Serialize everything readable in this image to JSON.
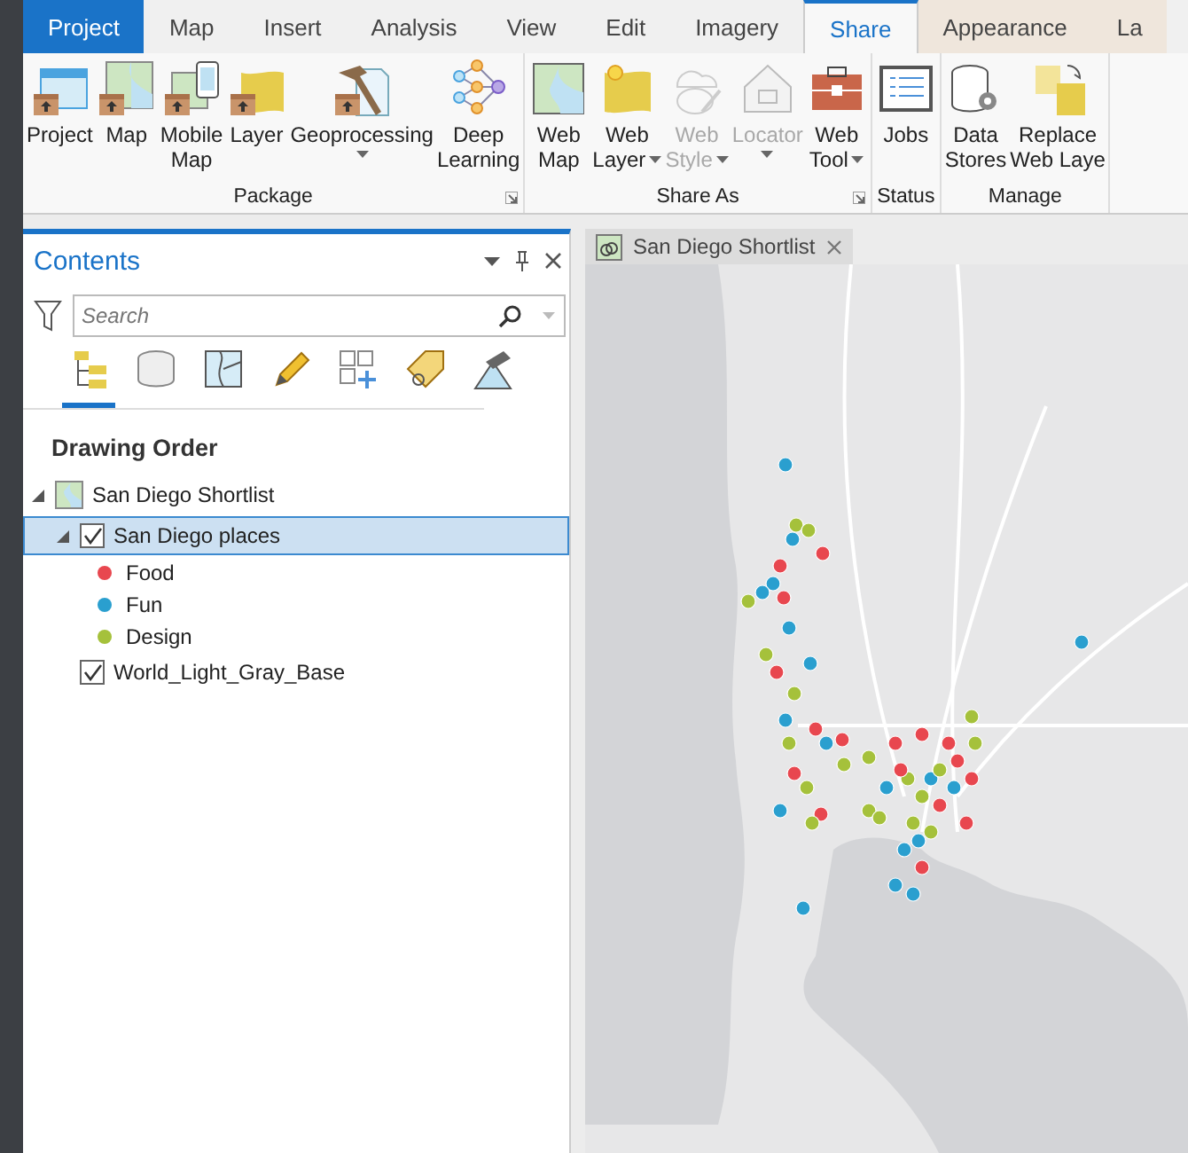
{
  "ribbon_tabs": [
    {
      "label": "Project",
      "kind": "file",
      "selected": false
    },
    {
      "label": "Map",
      "kind": "tab",
      "selected": false
    },
    {
      "label": "Insert",
      "kind": "tab",
      "selected": false
    },
    {
      "label": "Analysis",
      "kind": "tab",
      "selected": false
    },
    {
      "label": "View",
      "kind": "tab",
      "selected": false
    },
    {
      "label": "Edit",
      "kind": "tab",
      "selected": false
    },
    {
      "label": "Imagery",
      "kind": "tab",
      "selected": false
    },
    {
      "label": "Share",
      "kind": "tab",
      "selected": true
    },
    {
      "label": "Appearance",
      "kind": "contextual",
      "selected": false
    },
    {
      "label": "La",
      "kind": "contextual",
      "selected": false
    }
  ],
  "ribbon_groups": [
    {
      "label": "Package",
      "launcher": true,
      "buttons": [
        {
          "label": "Project",
          "dropdown": false,
          "disabled": false
        },
        {
          "label": "Map",
          "dropdown": false,
          "disabled": false
        },
        {
          "label": "Mobile\nMap",
          "dropdown": false,
          "disabled": false
        },
        {
          "label": "Layer",
          "dropdown": false,
          "disabled": false
        },
        {
          "label": "Geoprocessing",
          "dropdown": true,
          "disabled": false
        },
        {
          "label": "Deep\nLearning",
          "dropdown": false,
          "disabled": false
        }
      ]
    },
    {
      "label": "Share As",
      "launcher": true,
      "buttons": [
        {
          "label": "Web\nMap",
          "dropdown": false,
          "disabled": false
        },
        {
          "label": "Web\nLayer",
          "dropdown": true,
          "disabled": false
        },
        {
          "label": "Web\nStyle",
          "dropdown": true,
          "disabled": true
        },
        {
          "label": "Locator",
          "dropdown": true,
          "disabled": true
        },
        {
          "label": "Web\nTool",
          "dropdown": true,
          "disabled": false
        }
      ]
    },
    {
      "label": "Status",
      "buttons": [
        {
          "label": "Jobs",
          "dropdown": false,
          "disabled": false
        }
      ]
    },
    {
      "label": "Manage",
      "buttons": [
        {
          "label": "Data\nStores",
          "dropdown": false,
          "disabled": false
        },
        {
          "label": "Replace\nWeb Laye",
          "dropdown": false,
          "disabled": false
        }
      ]
    }
  ],
  "contents_pane": {
    "title": "Contents",
    "search": {
      "placeholder": "Search"
    },
    "view_tabs": [
      {
        "selected": true
      },
      {
        "selected": false
      },
      {
        "selected": false
      },
      {
        "selected": false
      },
      {
        "selected": false
      },
      {
        "selected": false
      },
      {
        "selected": false
      }
    ],
    "section_title": "Drawing Order",
    "tree": [
      {
        "label": "San Diego Shortlist",
        "kind": "map",
        "expanded": true,
        "children": [
          {
            "label": "San Diego places",
            "kind": "layer",
            "checked": true,
            "selected": true,
            "expanded": true,
            "legend": [
              {
                "label": "Food",
                "color": "#e8474f"
              },
              {
                "label": "Fun",
                "color": "#2a9fcf"
              },
              {
                "label": "Design",
                "color": "#a5c13b"
              }
            ]
          },
          {
            "label": "World_Light_Gray_Base",
            "kind": "layer",
            "checked": true,
            "selected": false
          }
        ]
      }
    ]
  },
  "map_view": {
    "tab": {
      "label": "San Diego Shortlist"
    }
  }
}
